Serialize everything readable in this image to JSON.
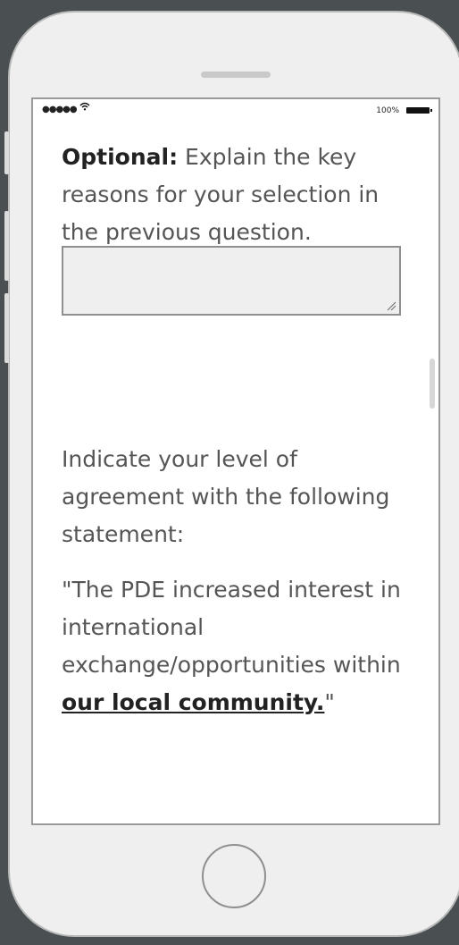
{
  "status_bar": {
    "signal": "●●●●●",
    "battery_percent": "100%"
  },
  "question1": {
    "label": "Optional:",
    "text": " Explain the key reasons for your selection in the previous question."
  },
  "answer_field": {
    "value": "",
    "placeholder": ""
  },
  "question2": {
    "intro": "Indicate your level of agreement with the following statement:",
    "quote_start": "\"The PDE increased interest in international exchange/opportunities within ",
    "emphasis": "our local community.",
    "quote_end": "\""
  }
}
